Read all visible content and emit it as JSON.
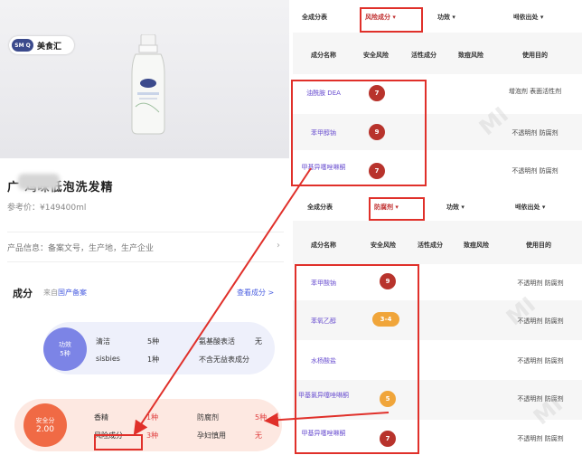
{
  "left": {
    "brand_logo": "SM Q",
    "brand_name": "美食汇",
    "product_name": "广  鸡味低泡洗发精",
    "price": "参考价：¥149400ml",
    "info": "产品信息：备案文号，生产地，生产企业",
    "ingredients_title": "成分",
    "ingredients_note_prefix": "来自",
    "ingredients_note_link": "国产备案",
    "view_all": "查看成分 >",
    "summary1": {
      "circle_label": "功效",
      "circle_value": "5种",
      "items": [
        {
          "label": "清洁",
          "value": "5种"
        },
        {
          "label": "sisbies",
          "value": "1种"
        },
        {
          "label": "氨基酸表活",
          "value": "无"
        },
        {
          "label": "不含无益表成分",
          "value": ""
        }
      ]
    },
    "summary2": {
      "circle_label": "安全分",
      "circle_value": "2.00",
      "items": [
        {
          "label": "香精",
          "value": "1种"
        },
        {
          "label": "风险成分",
          "value": "3种"
        },
        {
          "label": "防腐剂",
          "value": "5种"
        },
        {
          "label": "孕妇慎用",
          "value": "无"
        }
      ]
    }
  },
  "table1": {
    "tabs": [
      "全成分表",
      "风险成分 ▾",
      "功效 ▾",
      "배依出处 ▾"
    ],
    "headers": [
      "成分名称",
      "安全风险",
      "活性成分",
      "致痘风险",
      "使用目的"
    ],
    "rows": [
      {
        "name": "油酰胺 DEA",
        "risk": "7",
        "use": "增泡剂 表面活性剂"
      },
      {
        "name": "苯甲醇钠",
        "risk": "9",
        "use": "不透明剂 防腐剂"
      },
      {
        "name": "甲基异噻唑啉酮",
        "risk": "7",
        "use": "不透明剂 防腐剂"
      }
    ]
  },
  "table2": {
    "tabs": [
      "全成分表",
      "防腐剂 ▾",
      "功效 ▾",
      "배依出处 ▾"
    ],
    "headers": [
      "成分名称",
      "安全风险",
      "活性成分",
      "致痘风险",
      "使用目的"
    ],
    "rows": [
      {
        "name": "苯甲酸钠",
        "risk": "9",
        "use": "不透明剂 防腐剂"
      },
      {
        "name": "苯氧乙醇",
        "risk": "3-4",
        "use": "不透明剂 防腐剂"
      },
      {
        "name": "水杨酸盐",
        "risk": "",
        "use": "不透明剂 防腐剂"
      },
      {
        "name": "甲基氯异噻唑啉酮",
        "risk": "5",
        "use": "不透明剂 防腐剂"
      },
      {
        "name": "甲基异噻唑啉酮",
        "risk": "7",
        "use": "不透明剂 防腐剂"
      }
    ]
  },
  "colors": {
    "accent_red": "#e0302a",
    "badge_dark": "#b8332c",
    "badge_orange": "#f0a53a",
    "link_blue": "#4a5ee0"
  }
}
